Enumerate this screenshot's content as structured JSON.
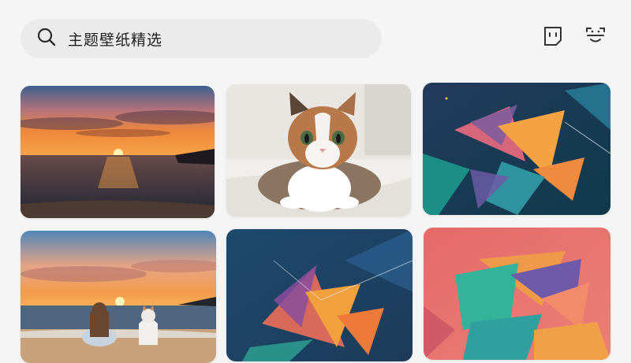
{
  "search": {
    "placeholder": "主题壁纸精选",
    "icon": "search-icon"
  },
  "toolbar": {
    "icons": [
      "theme-frame-icon",
      "face-scan-icon"
    ]
  },
  "gallery": {
    "items": [
      {
        "subject": "sunset-over-sea"
      },
      {
        "subject": "tabby-cat-on-blanket"
      },
      {
        "subject": "geometric-abstract-dark"
      },
      {
        "subject": "sunset-beach-girl-and-cat"
      },
      {
        "subject": "geometric-abstract-blue"
      },
      {
        "subject": "geometric-abstract-coral"
      }
    ]
  },
  "colors": {
    "background": "#f5f5f6",
    "search_bg": "#ebebeb",
    "icon": "#333333"
  }
}
